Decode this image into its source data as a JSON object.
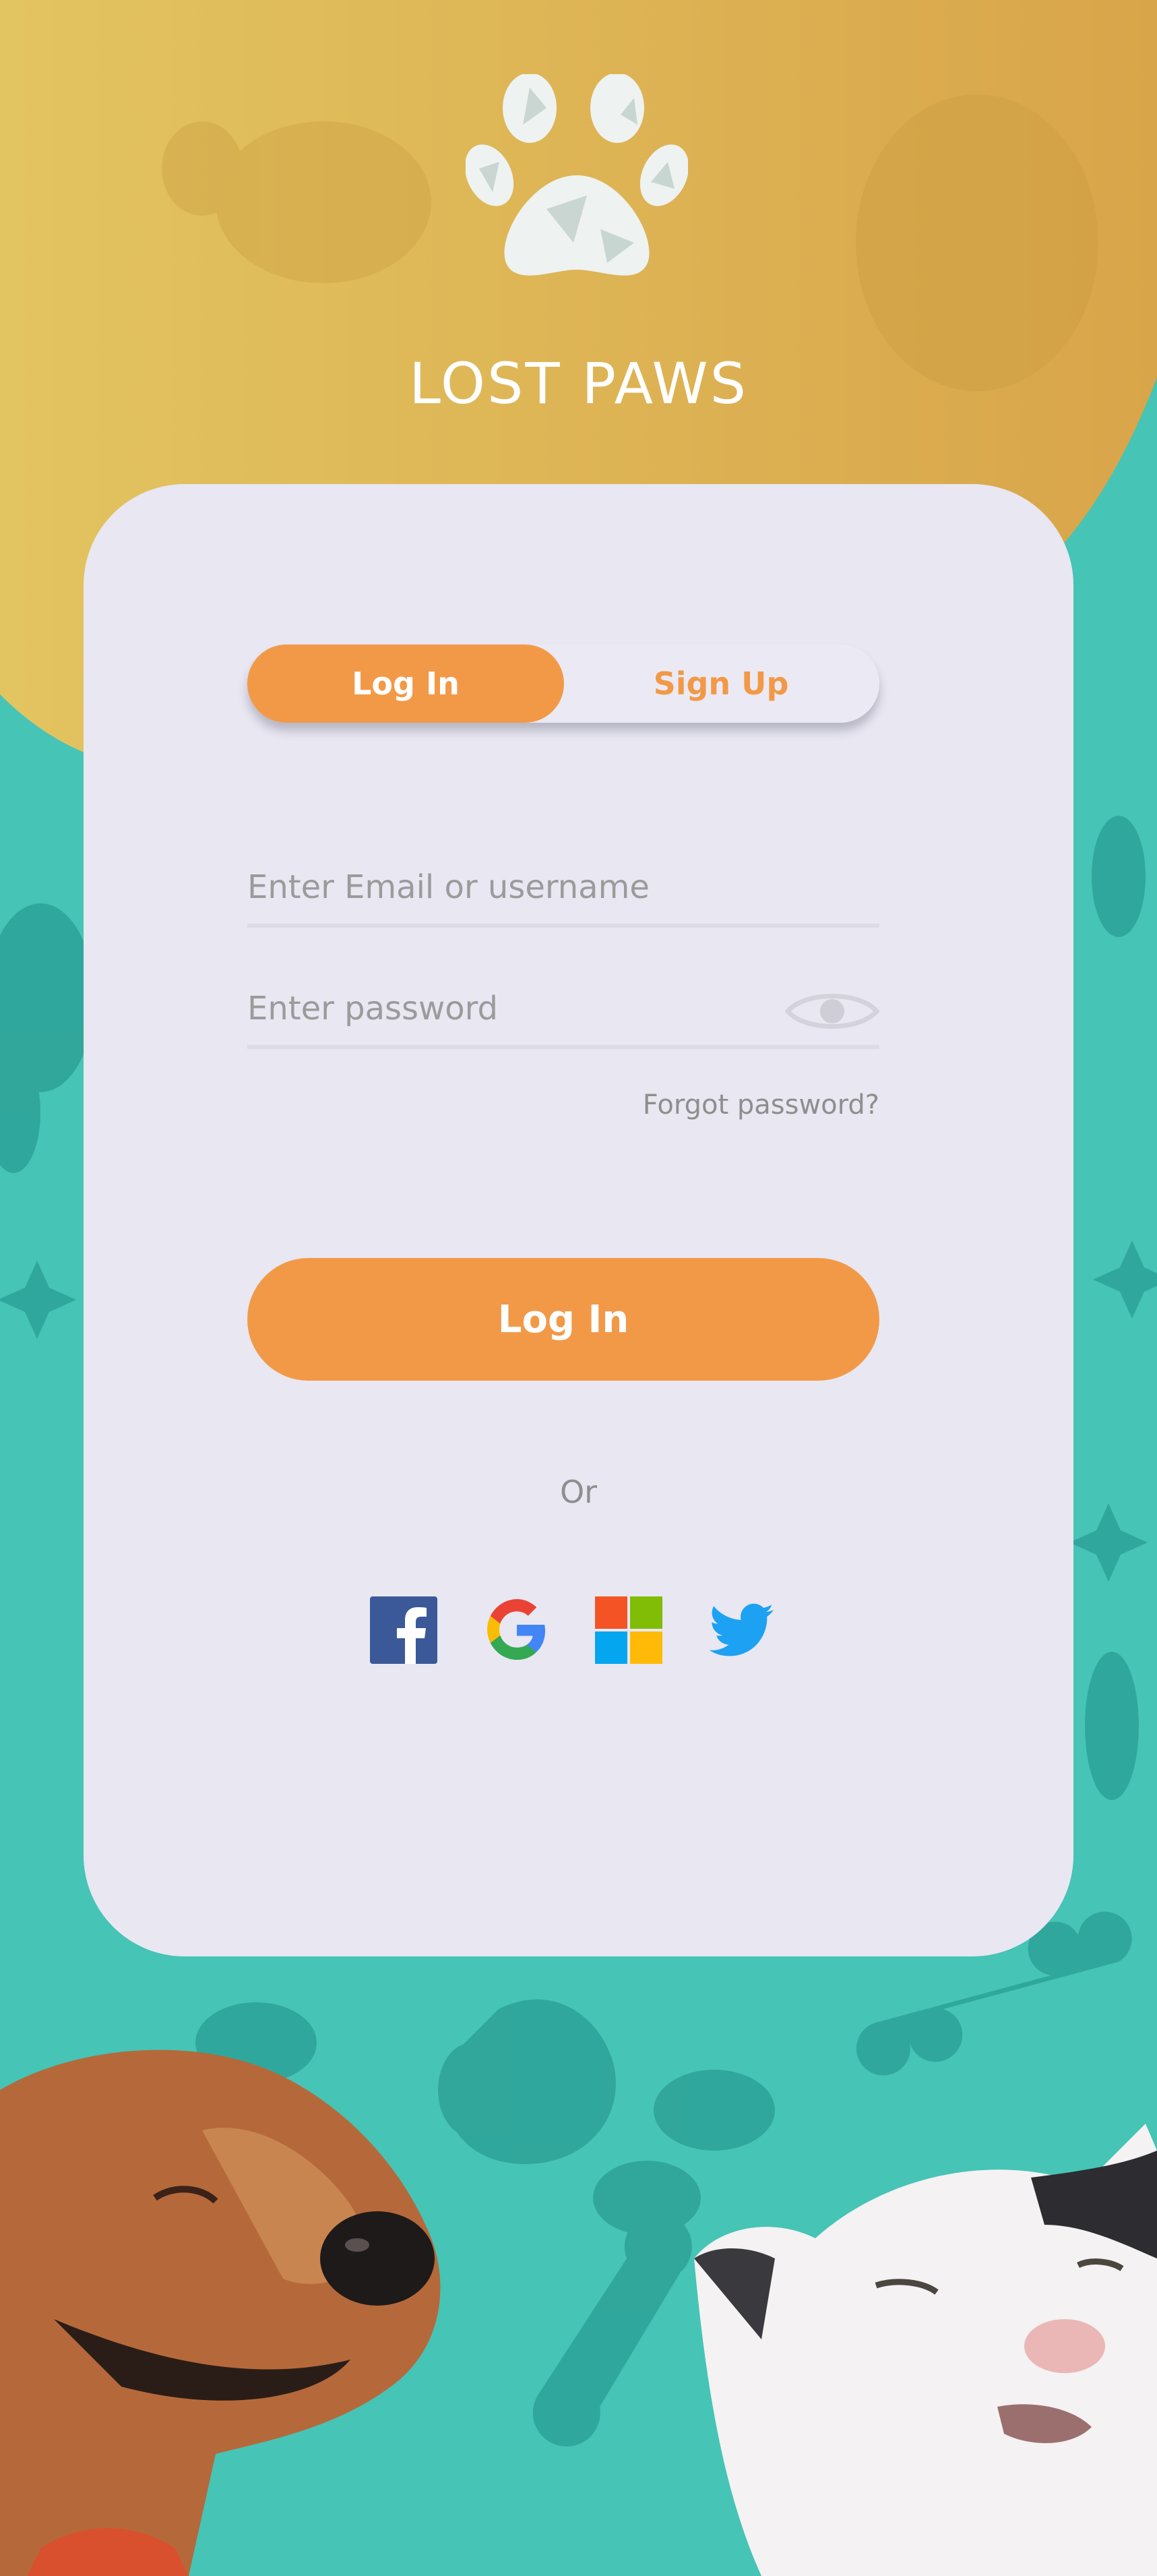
{
  "app": {
    "title": "LOST PAWS",
    "logo_icon": "paw-icon"
  },
  "colors": {
    "accent": "#f29948",
    "background_teal": "#46c4b6",
    "header_gold": "#dcb050",
    "card": "#e8e7f2",
    "placeholder": "#9b9b9b"
  },
  "tabs": {
    "login_label": "Log In",
    "signup_label": "Sign Up",
    "active": "Log In"
  },
  "form": {
    "email_placeholder": "Enter Email or username",
    "email_value": "",
    "password_placeholder": "Enter password",
    "password_value": "",
    "password_toggle_icon": "eye-icon",
    "forgot_label": "Forgot password?",
    "submit_label": "Log In"
  },
  "social": {
    "or_label": "Or",
    "providers": [
      "facebook-icon",
      "google-icon",
      "microsoft-icon",
      "twitter-icon"
    ]
  }
}
